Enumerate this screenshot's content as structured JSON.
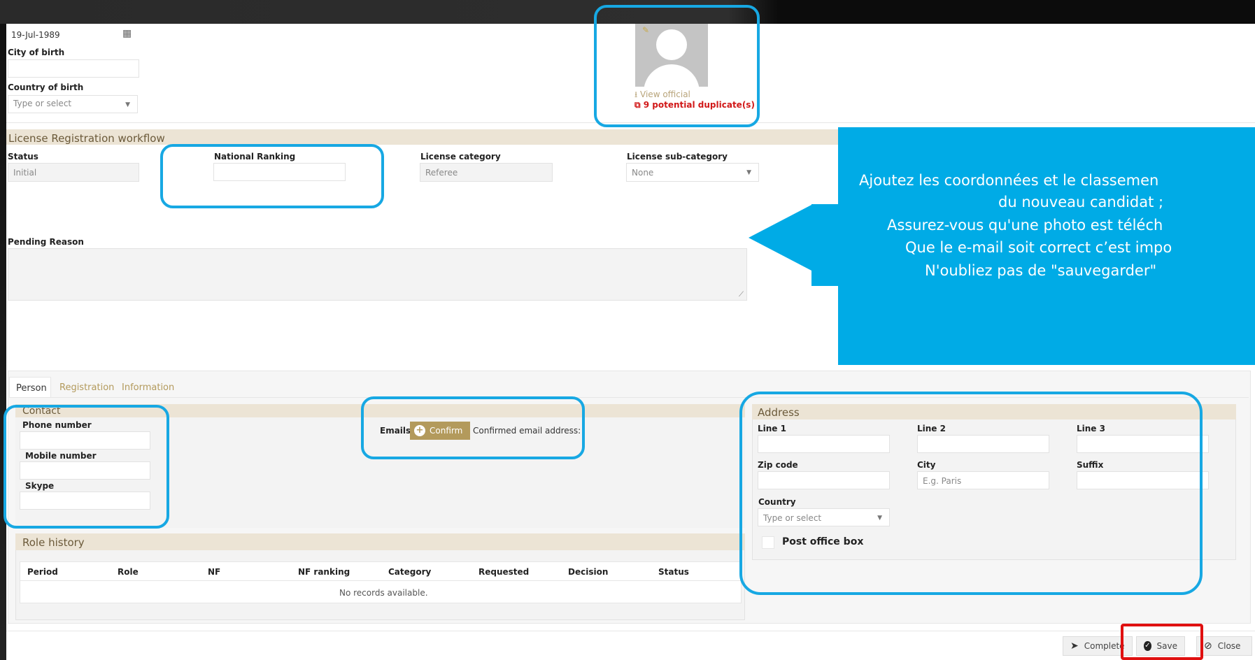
{
  "birth": {
    "date_value": "19-Jul-1989",
    "city_label": "City of birth",
    "country_label": "Country of birth",
    "country_placeholder": "Type or select"
  },
  "photo": {
    "view_official": "View official",
    "duplicates": "9 potential duplicate(s)"
  },
  "workflow": {
    "title": "License Registration workflow",
    "status_label": "Status",
    "status_value": "Initial",
    "ranking_label": "National Ranking",
    "category_label": "License category",
    "category_value": "Referee",
    "subcategory_label": "License sub-category",
    "subcategory_value": "None",
    "pending_label": "Pending Reason"
  },
  "callout": {
    "line1": "Ajoutez les coordonnées et le classemen",
    "line2": "du nouveau candidat ;",
    "line3": "Assurez-vous qu'une photo est téléch",
    "line4": "Que le e-mail soit correct c’est impo",
    "line5": "N'oubliez pas de \"sauvegarder\""
  },
  "tabs": [
    "Person",
    "Registration",
    "Information"
  ],
  "contact": {
    "title": "Contact",
    "phone_label": "Phone number",
    "mobile_label": "Mobile number",
    "skype_label": "Skype",
    "emails_label": "Emails",
    "confirm_label": "Confirm",
    "confirmed_text": "Confirmed email address:"
  },
  "address": {
    "title": "Address",
    "line1": "Line 1",
    "line2": "Line 2",
    "line3": "Line 3",
    "zip": "Zip code",
    "city": "City",
    "city_placeholder": "E.g. Paris",
    "suffix": "Suffix",
    "country": "Country",
    "country_placeholder": "Type or select",
    "po_box": "Post office box"
  },
  "role_history": {
    "title": "Role history",
    "columns": [
      "Period",
      "Role",
      "NF",
      "NF ranking",
      "Category",
      "Requested",
      "Decision",
      "Status"
    ],
    "empty": "No records available."
  },
  "footer": {
    "complete": "Complete",
    "save": "Save",
    "close": "Close"
  },
  "colors": {
    "accent_blue": "#17a8e3",
    "callout_blue": "#00abe6",
    "highlight_red": "#e01010",
    "tan": "#ece4d5",
    "confirm_gold": "#b39a5c"
  }
}
